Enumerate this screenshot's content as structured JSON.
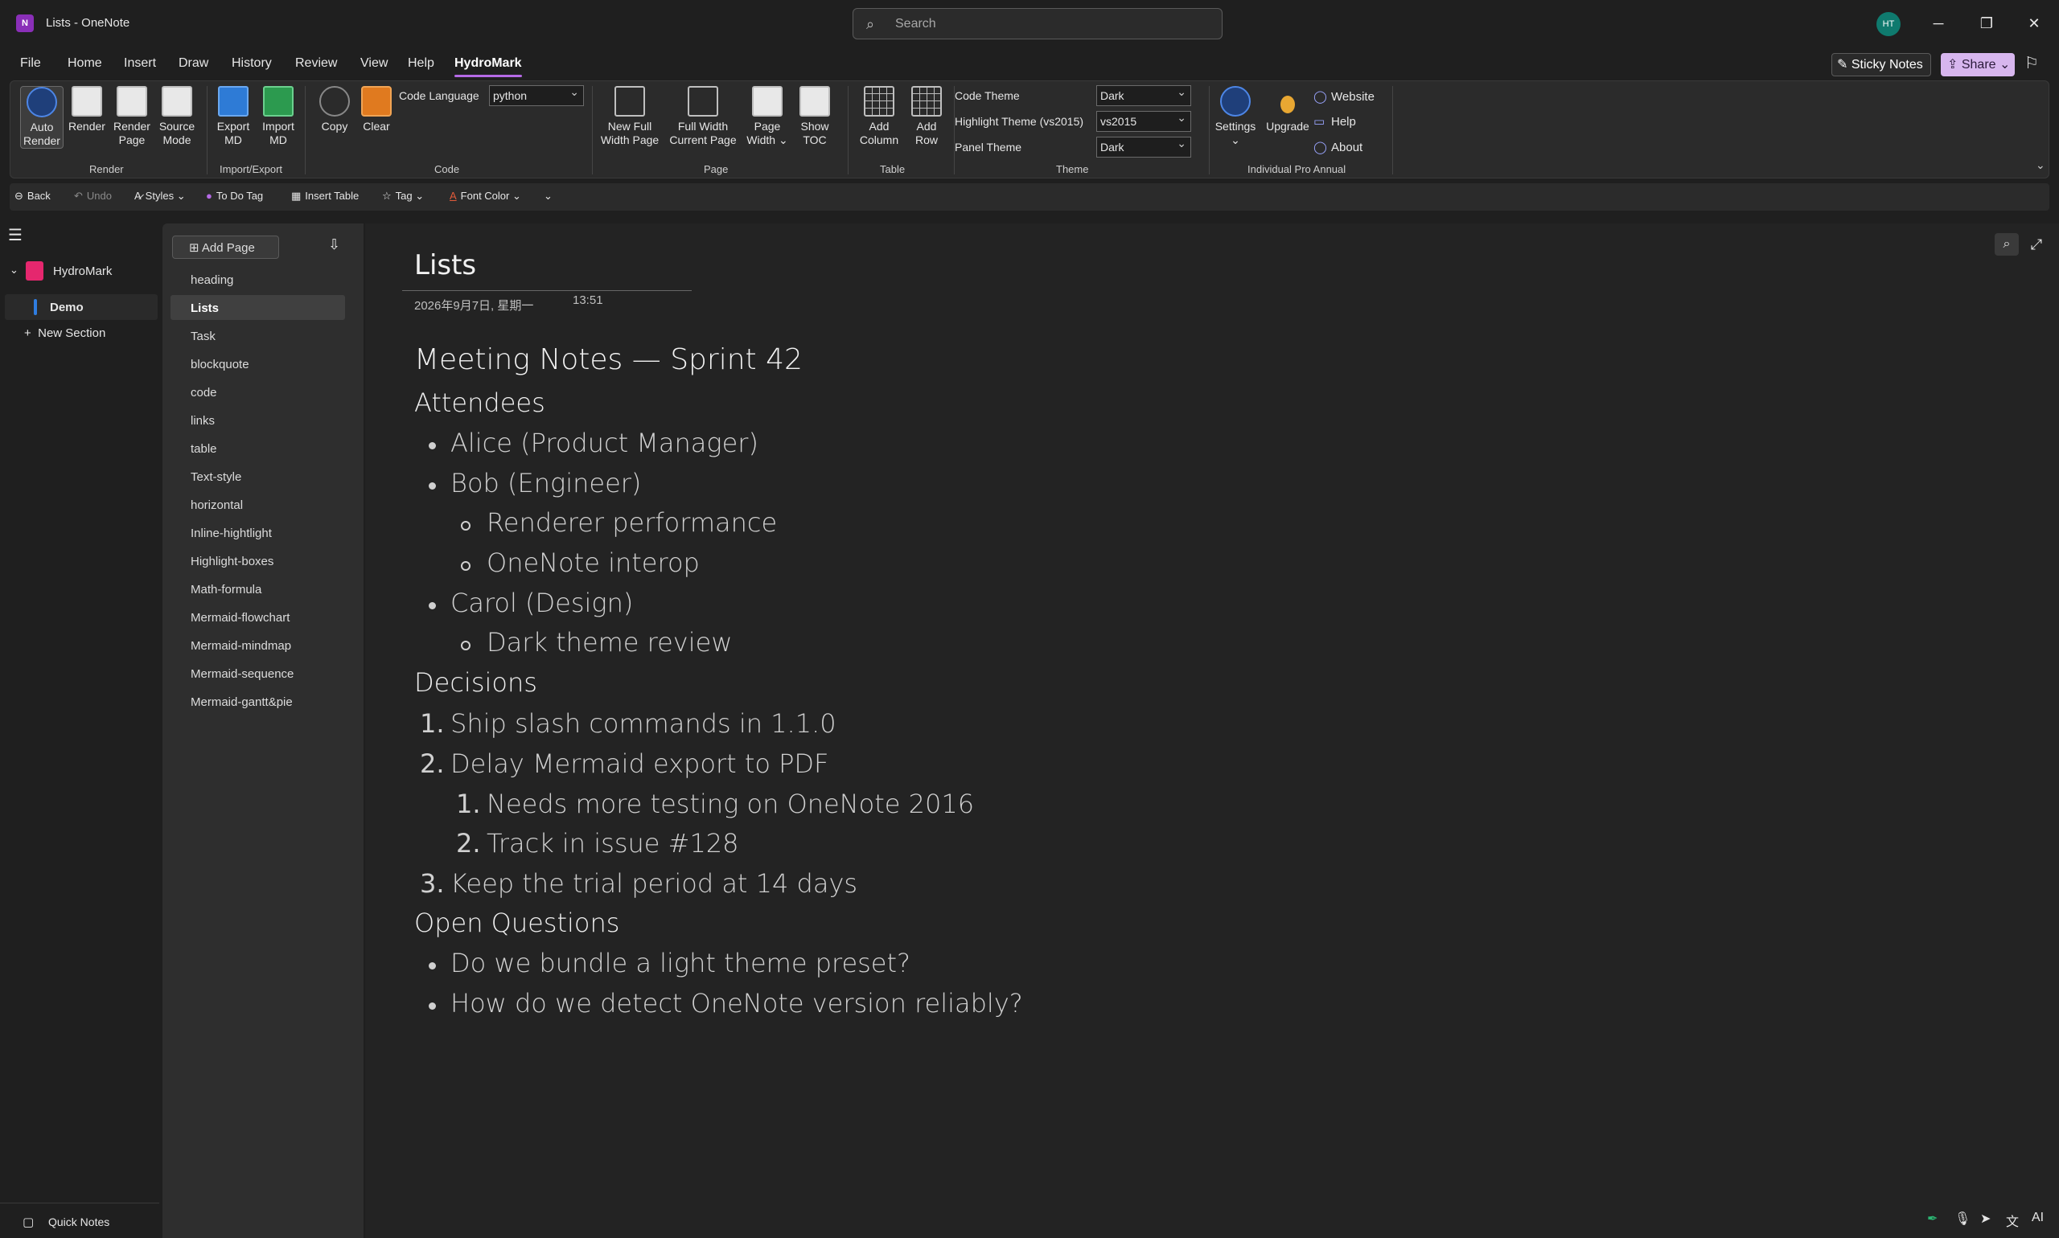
{
  "window": {
    "title": "Lists  -  OneNote",
    "search_placeholder": "Search",
    "avatar_initials": "HT",
    "minimize": "─",
    "restore": "❐",
    "close": "✕"
  },
  "menu": {
    "tabs": [
      "File",
      "Home",
      "Insert",
      "Draw",
      "History",
      "Review",
      "View",
      "Help",
      "HydroMark"
    ],
    "active_tab": "HydroMark",
    "sticky_notes": "Sticky Notes",
    "share": "Share"
  },
  "ribbon": {
    "render_group": {
      "label": "Render",
      "auto_render": [
        "Auto",
        "Render"
      ],
      "render": [
        "Render"
      ],
      "render_page": [
        "Render",
        "Page"
      ],
      "source_mode": [
        "Source",
        "Mode"
      ]
    },
    "import_export_group": {
      "label": "Import/Export",
      "export_md": [
        "Export",
        "MD"
      ],
      "import_md": [
        "Import",
        "MD"
      ]
    },
    "code_group": {
      "label": "Code",
      "copy": "Copy",
      "clear": "Clear",
      "code_language_label": "Code Language",
      "code_language_value": "python"
    },
    "page_group": {
      "label": "Page",
      "new_full_width": [
        "New Full",
        "Width Page"
      ],
      "full_width_current": [
        "Full Width",
        "Current Page"
      ],
      "page_width": [
        "Page",
        "Width ⌄"
      ],
      "show_toc": [
        "Show",
        "TOC"
      ]
    },
    "table_group": {
      "label": "Table",
      "add_column": [
        "Add",
        "Column"
      ],
      "add_row": [
        "Add",
        "Row"
      ]
    },
    "theme_group": {
      "label": "Theme",
      "code_theme_label": "Code Theme",
      "code_theme_value": "Dark",
      "highlight_theme_label": "Highlight Theme (vs2015)",
      "highlight_theme_value": "vs2015",
      "panel_theme_label": "Panel Theme",
      "panel_theme_value": "Dark"
    },
    "pro_group": {
      "label": "Individual Pro Annual",
      "settings": "Settings",
      "upgrade": "Upgrade",
      "website": "Website",
      "help": "Help",
      "about": "About"
    }
  },
  "quick_toolbar": {
    "back": "Back",
    "undo": "Undo",
    "styles": "Styles",
    "todo_tag": "To Do Tag",
    "insert_table": "Insert Table",
    "tag": "Tag",
    "font_color": "Font Color"
  },
  "navigation": {
    "notebook": "HydroMark",
    "section": "Demo",
    "new_section": "New Section",
    "quick_notes": "Quick Notes"
  },
  "pages": {
    "add_page": "Add Page",
    "items": [
      "heading",
      "Lists",
      "Task",
      "blockquote",
      "code",
      "links",
      "table",
      "Text-style",
      "horizontal",
      "Inline-hightlight",
      "Highlight-boxes",
      "Math-formula",
      "Mermaid-flowchart",
      "Mermaid-mindmap",
      "Mermaid-sequence",
      "Mermaid-gantt&pie"
    ],
    "selected": "Lists"
  },
  "note": {
    "title": "Lists",
    "date": "2026年9月7日, 星期一",
    "time": "13:51",
    "heading": "Meeting Notes — Sprint 42",
    "attendees_heading": "Attendees",
    "attendee_1": "Alice (Product Manager)",
    "attendee_2": "Bob (Engineer)",
    "attendee_2_sub_1": "Renderer performance",
    "attendee_2_sub_2": "OneNote interop",
    "attendee_3": "Carol (Design)",
    "attendee_3_sub_1": "Dark theme review",
    "decisions_heading": "Decisions",
    "decision_1_num": "1.",
    "decision_1": "Ship slash commands in 1.1.0",
    "decision_2_num": "2.",
    "decision_2": "Delay Mermaid export to PDF",
    "decision_2_sub_1_num": "1.",
    "decision_2_sub_1": "Needs more testing on OneNote 2016",
    "decision_2_sub_2_num": "2.",
    "decision_2_sub_2": "Track in issue #128",
    "decision_3_num": "3.",
    "decision_3": "Keep the trial period at 14 days",
    "questions_heading": "Open Questions",
    "question_1": "Do we bundle a light theme preset?",
    "question_2": "How do we detect OneNote version reliably?"
  },
  "status": {
    "ai": "AI"
  },
  "colors": {
    "accent": "#b56ae6",
    "notebook": "#e5276e",
    "section": "#2f7de0",
    "avatar": "#0f7a6e"
  }
}
